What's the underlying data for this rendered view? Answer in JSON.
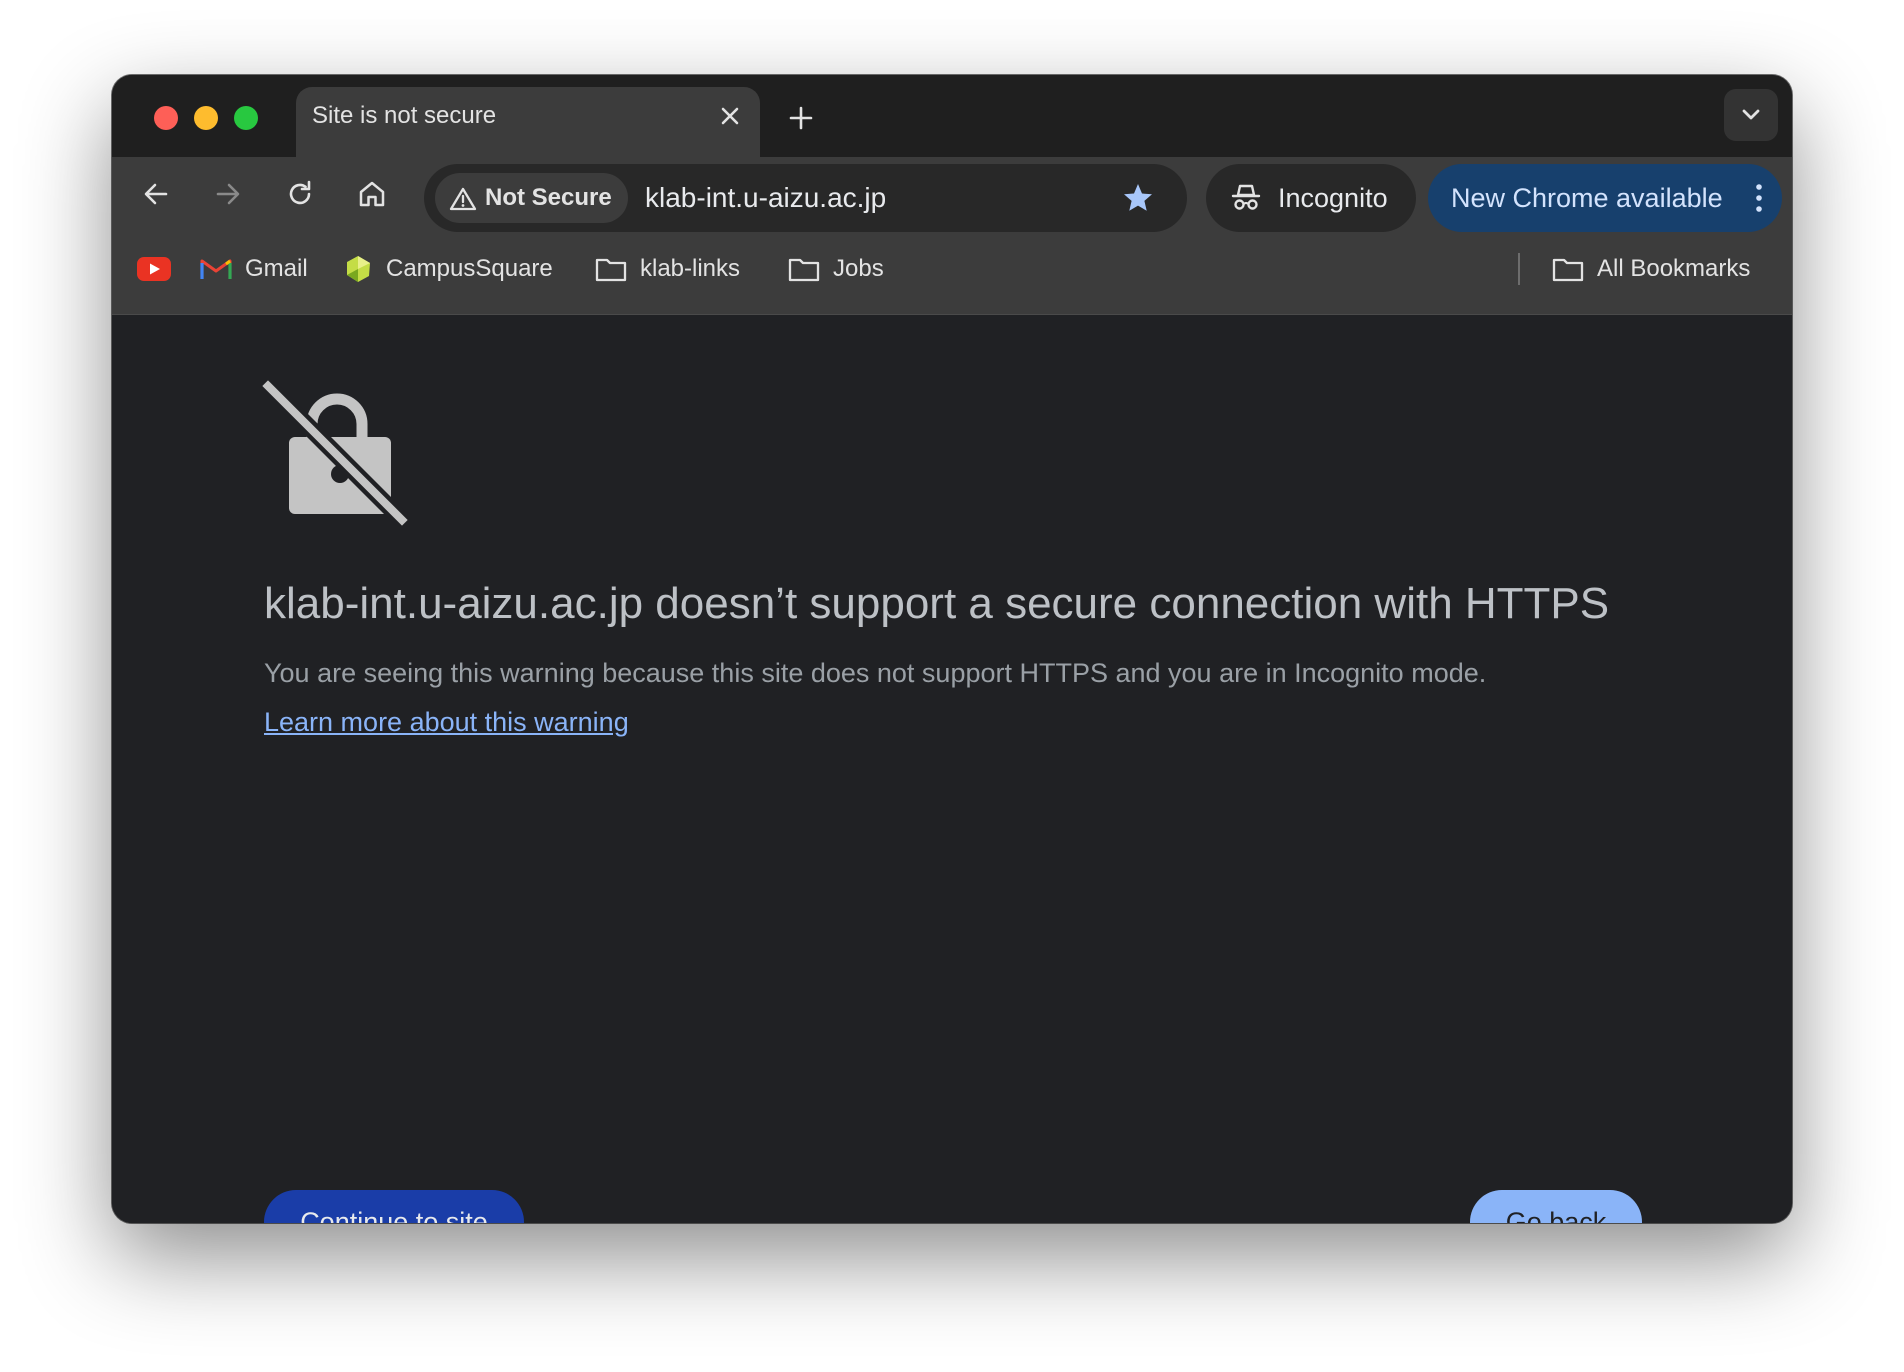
{
  "window": {
    "traffic_lights": [
      "close",
      "minimize",
      "zoom"
    ]
  },
  "tab": {
    "title": "Site is not secure"
  },
  "toolbar": {
    "security_chip": "Not Secure",
    "url": "klab-int.u-aizu.ac.jp",
    "incognito_label": "Incognito",
    "update_label": "New Chrome available"
  },
  "bookmarks": {
    "items": [
      {
        "label": "",
        "icon": "youtube-icon"
      },
      {
        "label": "Gmail",
        "icon": "gmail-icon"
      },
      {
        "label": "CampusSquare",
        "icon": "campussquare-icon"
      },
      {
        "label": "klab-links",
        "icon": "folder-icon"
      },
      {
        "label": "Jobs",
        "icon": "folder-icon"
      }
    ],
    "all_bookmarks": "All Bookmarks"
  },
  "page": {
    "heading": "klab-int.u-aizu.ac.jp doesn’t support a secure connection with HTTPS",
    "body": "You are seeing this warning because this site does not support HTTPS and you are in Incognito mode.",
    "learn_more": "Learn more about this warning",
    "continue_button": "Continue to site",
    "back_button": "Go back"
  },
  "colors": {
    "page_bg": "#202124",
    "toolbar_bg": "#3c3c3c",
    "link": "#8ab4f8",
    "primary_button": "#1a3da8",
    "secondary_button": "#8ab4f8",
    "update_pill": "#17406d"
  }
}
